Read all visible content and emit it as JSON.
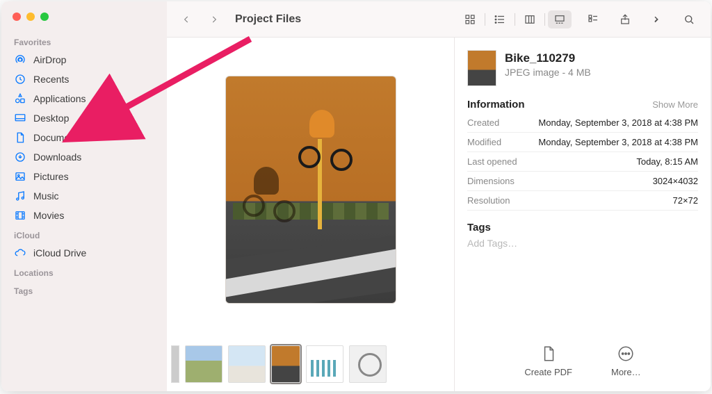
{
  "window_title": "Project Files",
  "sidebar": {
    "sections": [
      {
        "label": "Favorites",
        "items": [
          {
            "icon": "airdrop-icon",
            "label": "AirDrop"
          },
          {
            "icon": "clock-icon",
            "label": "Recents"
          },
          {
            "icon": "apps-icon",
            "label": "Applications"
          },
          {
            "icon": "desktop-icon",
            "label": "Desktop"
          },
          {
            "icon": "document-icon",
            "label": "Documents"
          },
          {
            "icon": "download-icon",
            "label": "Downloads"
          },
          {
            "icon": "photo-icon",
            "label": "Pictures"
          },
          {
            "icon": "music-icon",
            "label": "Music"
          },
          {
            "icon": "film-icon",
            "label": "Movies"
          }
        ]
      },
      {
        "label": "iCloud",
        "items": [
          {
            "icon": "cloud-icon",
            "label": "iCloud Drive"
          }
        ]
      },
      {
        "label": "Locations",
        "items": []
      },
      {
        "label": "Tags",
        "items": []
      }
    ]
  },
  "file": {
    "name": "Bike_110279",
    "kind_label": "JPEG image - 4 MB"
  },
  "info": {
    "heading": "Information",
    "show_more_label": "Show More",
    "rows": [
      {
        "k": "Created",
        "v": "Monday, September 3, 2018 at 4:38 PM"
      },
      {
        "k": "Modified",
        "v": "Monday, September 3, 2018 at 4:38 PM"
      },
      {
        "k": "Last opened",
        "v": "Today, 8:15 AM"
      },
      {
        "k": "Dimensions",
        "v": "3024×4032"
      },
      {
        "k": "Resolution",
        "v": "72×72"
      }
    ]
  },
  "tags": {
    "heading": "Tags",
    "placeholder": "Add Tags…"
  },
  "actions": {
    "create_pdf": "Create PDF",
    "more": "More…"
  }
}
